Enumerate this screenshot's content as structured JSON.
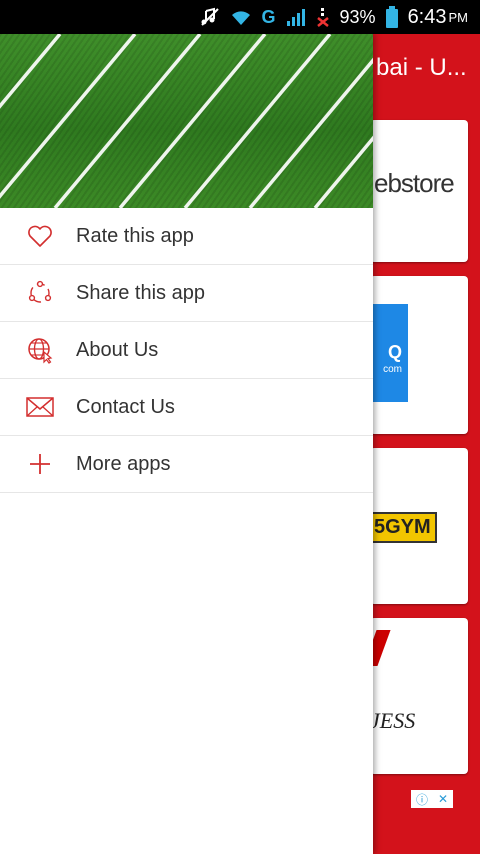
{
  "status_bar": {
    "network": "G",
    "battery": "93%",
    "time": "6:43",
    "ampm": "PM"
  },
  "background_app": {
    "title": "bai - U...",
    "cards": [
      {
        "text": "ebstore"
      },
      {
        "text": "Q",
        "subtext": "com"
      },
      {
        "text": "5GYM"
      },
      {
        "text": "JESS"
      }
    ]
  },
  "drawer": {
    "menu": [
      {
        "label": "Rate this app",
        "icon": "heart-icon"
      },
      {
        "label": "Share this app",
        "icon": "share-icon"
      },
      {
        "label": "About Us",
        "icon": "globe-icon"
      },
      {
        "label": "Contact Us",
        "icon": "envelope-icon"
      },
      {
        "label": "More apps",
        "icon": "plus-icon"
      }
    ]
  },
  "colors": {
    "accent": "#d3121b",
    "icon": "#d32f2f",
    "status_net": "#33b5e5"
  }
}
